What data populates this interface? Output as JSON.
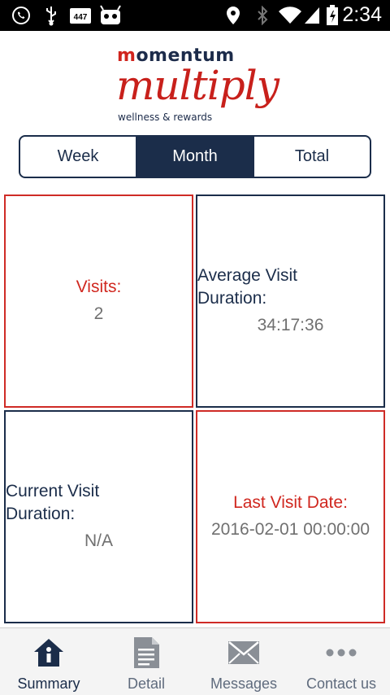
{
  "status_bar": {
    "time": "2:34",
    "icons": [
      "whatsapp-icon",
      "usb-icon",
      "notification-447-icon",
      "android-icon",
      "location-icon",
      "bluetooth-icon",
      "wifi-icon",
      "signal-icon",
      "battery-icon"
    ],
    "badge_number": "447"
  },
  "logo": {
    "brand_prefix": "m",
    "brand_rest": "omentum",
    "script": "multiply",
    "tagline": "wellness & rewards"
  },
  "period_tabs": [
    {
      "label": "Week",
      "active": false
    },
    {
      "label": "Month",
      "active": true
    },
    {
      "label": "Total",
      "active": false
    }
  ],
  "stats": {
    "visits": {
      "label": "Visits:",
      "value": "2"
    },
    "average_duration": {
      "label": "Average Visit Duration:",
      "value": "34:17:36"
    },
    "current_duration": {
      "label": "Current Visit Duration:",
      "value": "N/A"
    },
    "last_visit": {
      "label": "Last Visit Date:",
      "value": "2016-02-01 00:00:00"
    }
  },
  "bottom_nav": [
    {
      "label": "Summary",
      "icon": "house-info-icon",
      "active": true
    },
    {
      "label": "Detail",
      "icon": "document-icon",
      "active": false
    },
    {
      "label": "Messages",
      "icon": "envelope-icon",
      "active": false
    },
    {
      "label": "Contact us",
      "icon": "more-dots-icon",
      "active": false
    }
  ],
  "colors": {
    "navy": "#1b2d4a",
    "red": "#cf2b26",
    "value_gray": "#707070"
  }
}
